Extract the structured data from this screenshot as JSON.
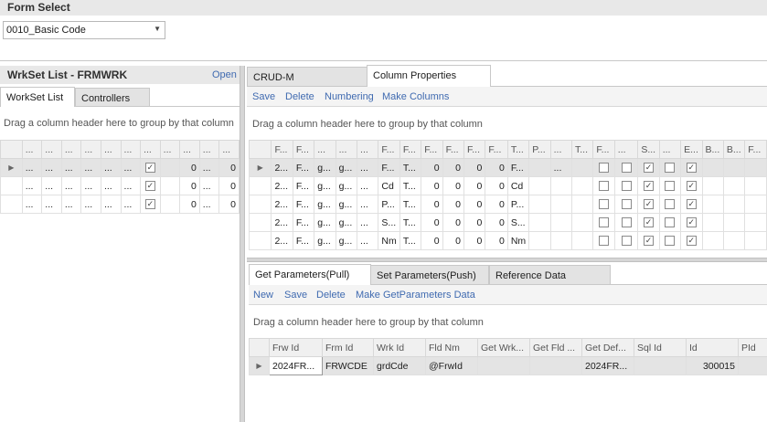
{
  "form_select": {
    "title": "Form Select",
    "selected": "0010_Basic Code"
  },
  "left": {
    "title": "WrkSet List - FRMWRK",
    "open_label": "Open",
    "tabs": [
      "WorkSet List",
      "Controllers"
    ],
    "group_hint": "Drag a column header here to group by that column",
    "header": [
      "...",
      "...",
      "...",
      "...",
      "...",
      "...",
      "...",
      "...",
      "...",
      "...",
      "..."
    ],
    "rows": [
      [
        "...",
        "...",
        "...",
        "...",
        "...",
        "...",
        "",
        "0",
        "...",
        "0"
      ],
      [
        "...",
        "...",
        "...",
        "...",
        "...",
        "...",
        "",
        "0",
        "...",
        "0"
      ],
      [
        "...",
        "...",
        "...",
        "...",
        "...",
        "...",
        "",
        "0",
        "...",
        "0"
      ]
    ]
  },
  "right_top": {
    "tabs": [
      "CRUD-M",
      "Column Properties"
    ],
    "actions": [
      "Save",
      "Delete",
      "Numbering",
      "Make Columns"
    ],
    "group_hint": "Drag a column header here to group by that column",
    "header": [
      "F...",
      "F...",
      "...",
      "...",
      "...",
      "F...",
      "F...",
      "F...",
      "F...",
      "F...",
      "F...",
      "T...",
      "P...",
      "...",
      "T...",
      "F...",
      "...",
      "S...",
      "...",
      "E...",
      "B...",
      "B...",
      "F..."
    ],
    "rows": [
      [
        "2...",
        "F...",
        "g...",
        "g...",
        "...",
        "F...",
        "T...",
        "0",
        "0",
        "0",
        "0",
        "F...",
        "",
        "...",
        ""
      ],
      [
        "2...",
        "F...",
        "g...",
        "g...",
        "...",
        "Cd",
        "T...",
        "0",
        "0",
        "0",
        "0",
        "Cd",
        "",
        "",
        ""
      ],
      [
        "2...",
        "F...",
        "g...",
        "g...",
        "...",
        "P...",
        "T...",
        "0",
        "0",
        "0",
        "0",
        "P...",
        "",
        "",
        ""
      ],
      [
        "2...",
        "F...",
        "g...",
        "g...",
        "...",
        "S...",
        "T...",
        "0",
        "0",
        "0",
        "0",
        "S...",
        "",
        "",
        ""
      ],
      [
        "2...",
        "F...",
        "g...",
        "g...",
        "...",
        "Nm",
        "T...",
        "0",
        "0",
        "0",
        "0",
        "Nm",
        "",
        "",
        ""
      ]
    ]
  },
  "right_bottom": {
    "tabs": [
      "Get Parameters(Pull)",
      "Set Parameters(Push)",
      "Reference Data"
    ],
    "actions": [
      "New",
      "Save",
      "Delete",
      "Make GetParameters Data"
    ],
    "group_hint": "Drag a column header here to group by that column",
    "header": [
      "Frw Id",
      "Frm Id",
      "Wrk Id",
      "Fld Nm",
      "Get Wrk...",
      "Get Fld ...",
      "Get Def...",
      "Sql Id",
      "Id",
      "PId"
    ],
    "rows": [
      [
        "2024FR...",
        "FRWCDE",
        "grdCde",
        "@FrwId",
        "",
        "",
        "2024FR...",
        "",
        "300015",
        ""
      ]
    ]
  }
}
